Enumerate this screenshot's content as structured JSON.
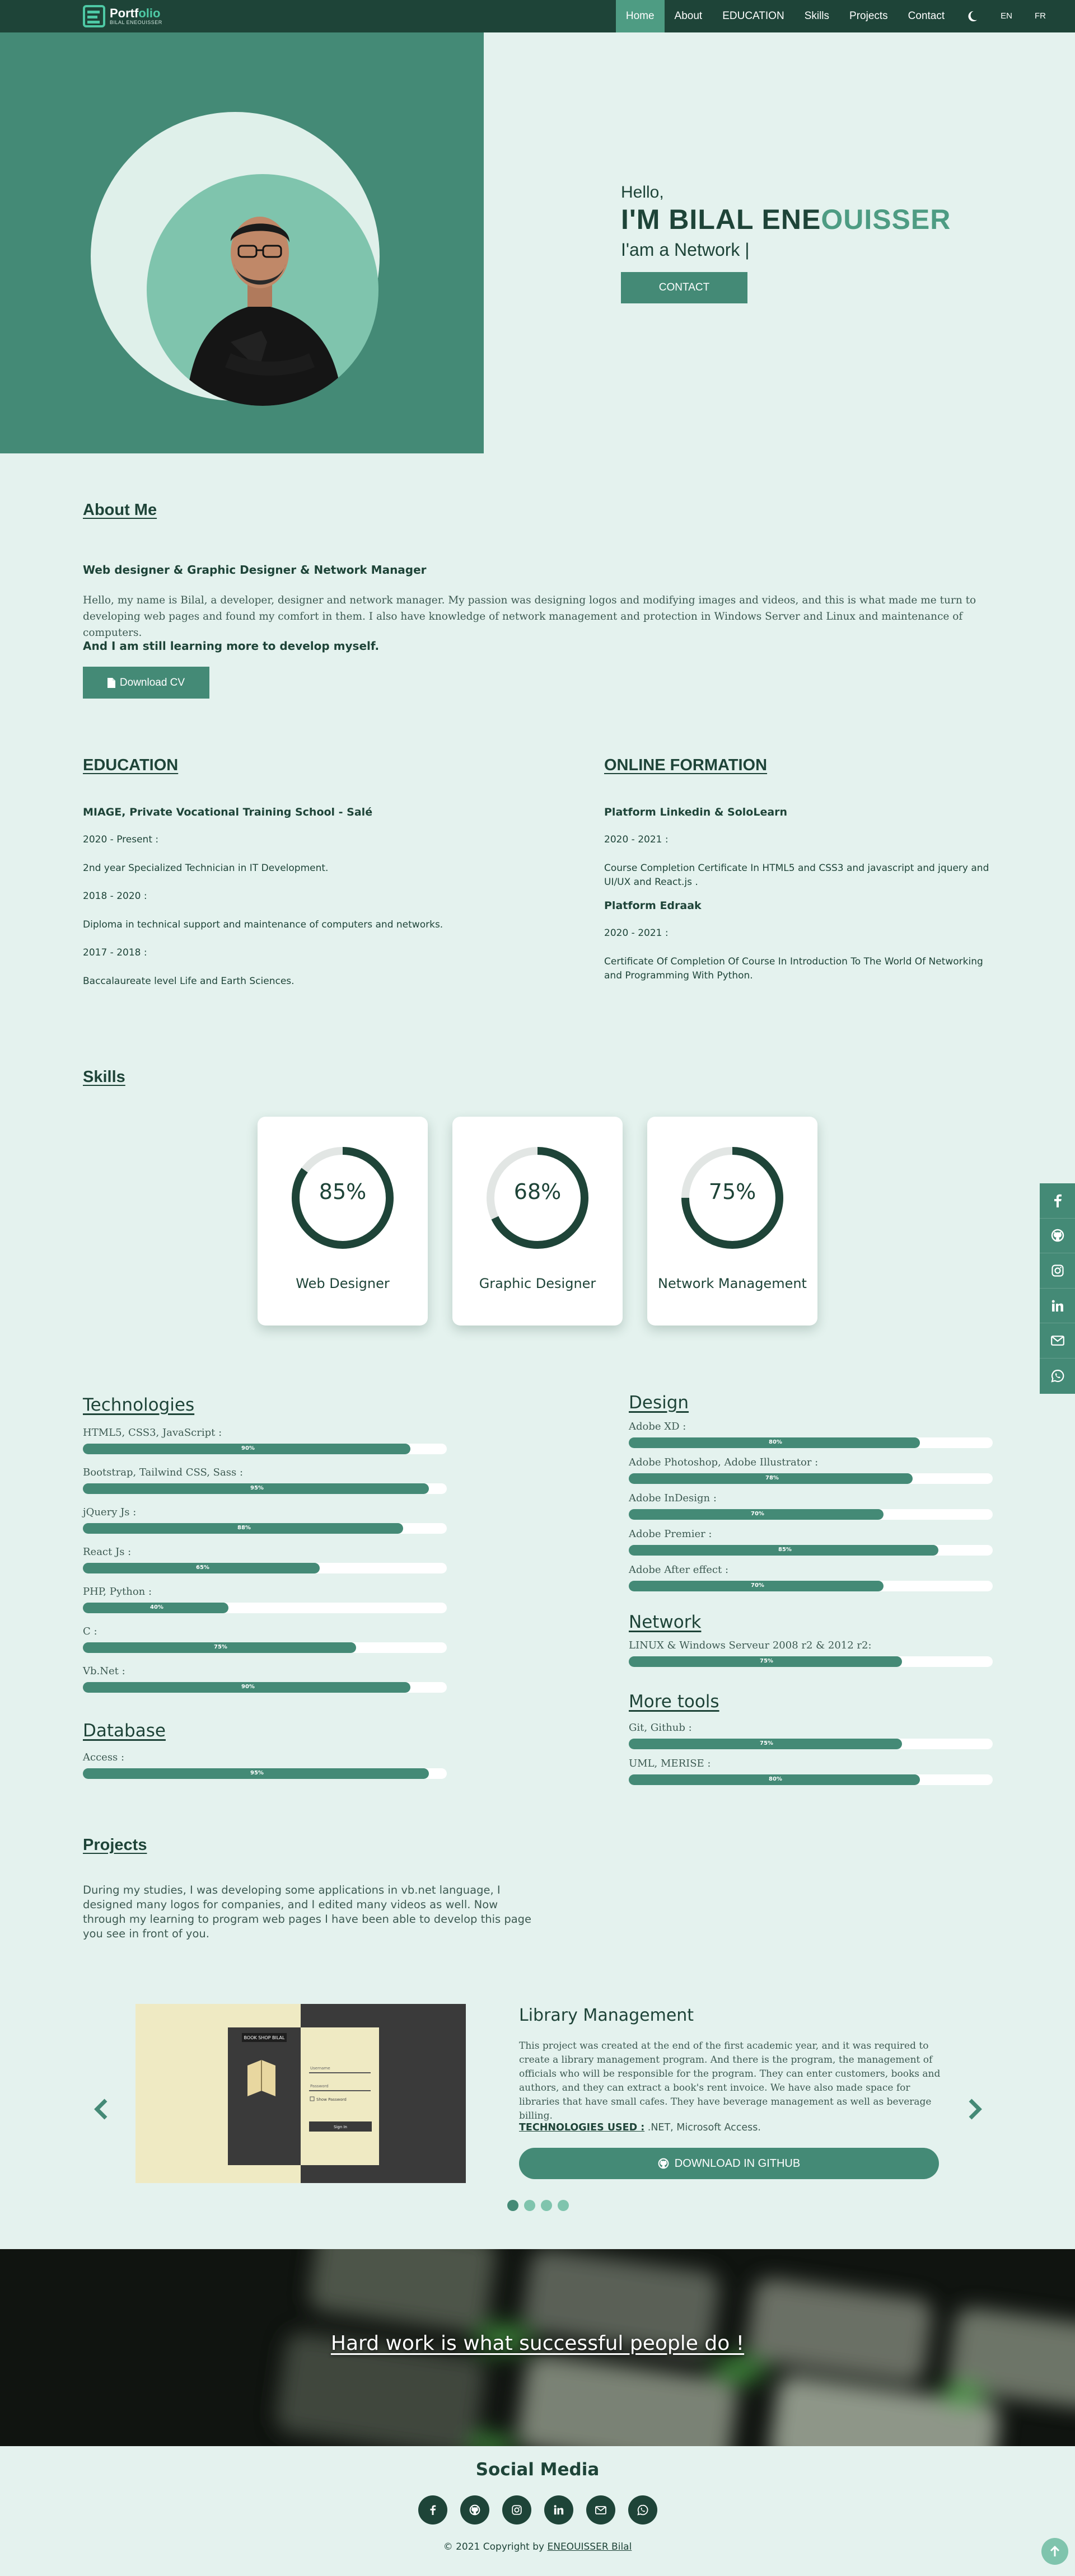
{
  "nav": {
    "logo_title_prefix": "Portf",
    "logo_title_accent": "olio",
    "logo_subtitle": "BILAL ENEOUISSER",
    "items": [
      "Home",
      "About",
      "EDUCATION",
      "Skills",
      "Projects",
      "Contact"
    ],
    "active": "Home",
    "theme_icon": "moon-icon",
    "languages": [
      "EN",
      "FR"
    ]
  },
  "hero": {
    "greeting": "Hello,",
    "name_prefix": "I'M BILAL ENE",
    "name_accent": "OUISSER",
    "typed": "I'am a Network |",
    "button": "CONTACT"
  },
  "about": {
    "heading": "About Me",
    "subtitle": "Web designer & Graphic Designer & Network Manager",
    "text": "Hello, my name is Bilal, a developer, designer and network manager. My passion was designing logos and modifying images and videos, and this is what made me turn to developing web pages and found my comfort in them. I also have knowledge of network management and protection in Windows Server and Linux and maintenance of computers.",
    "learning": "And I am still learning more to develop myself.",
    "cv_button": "Download CV"
  },
  "education": {
    "heading": "EDUCATION",
    "school": "MIAGE, Private Vocational Training School - Salé",
    "entries": [
      {
        "period": "2020 - Present :",
        "detail": "2nd year Specialized Technician in IT Development."
      },
      {
        "period": "2018 - 2020 :",
        "detail": "Diploma in technical support and maintenance of computers and networks."
      },
      {
        "period": "2017 - 2018 :",
        "detail": "Baccalaureate level Life and Earth Sciences."
      }
    ]
  },
  "online": {
    "heading": "ONLINE FORMATION",
    "platforms": [
      {
        "name": "Platform Linkedin & SoloLearn",
        "period": "2020 - 2021 :",
        "detail": "Course Completion Certificate In HTML5 and CSS3 and javascript and jquery and UI/UX and React.js ."
      },
      {
        "name": "Platform Edraak",
        "period": "2020 - 2021 :",
        "detail": "Certificate Of Completion Of Course In Introduction To The World Of Networking and Programming With Python."
      }
    ]
  },
  "skills": {
    "heading": "Skills",
    "cards": [
      {
        "value": 85,
        "label": "85%",
        "name": "Web Designer"
      },
      {
        "value": 68,
        "label": "68%",
        "name": "Graphic Designer"
      },
      {
        "value": 75,
        "label": "75%",
        "name": "Network Management"
      }
    ]
  },
  "side_social": [
    "facebook-icon",
    "github-icon",
    "instagram-icon",
    "linkedin-icon",
    "email-icon",
    "whatsapp-icon"
  ],
  "bars": {
    "technologies": {
      "heading": "Technologies",
      "items": [
        {
          "label": "HTML5, CSS3, JavaScript :",
          "value": 90,
          "text": "90%"
        },
        {
          "label": "Bootstrap, Tailwind CSS, Sass :",
          "value": 95,
          "text": "95%"
        },
        {
          "label": "jQuery Js :",
          "value": 88,
          "text": "88%"
        },
        {
          "label": "React Js :",
          "value": 65,
          "text": "65%"
        },
        {
          "label": "PHP, Python :",
          "value": 40,
          "text": "40%"
        },
        {
          "label": "C :",
          "value": 75,
          "text": "75%"
        },
        {
          "label": "Vb.Net :",
          "value": 90,
          "text": "90%"
        }
      ]
    },
    "database": {
      "heading": "Database",
      "items": [
        {
          "label": "Access :",
          "value": 95,
          "text": "95%"
        }
      ]
    },
    "design": {
      "heading": "Design",
      "items": [
        {
          "label": "Adobe XD :",
          "value": 80,
          "text": "80%"
        },
        {
          "label": "Adobe Photoshop, Adobe Illustrator :",
          "value": 78,
          "text": "78%"
        },
        {
          "label": "Adobe InDesign :",
          "value": 70,
          "text": "70%"
        },
        {
          "label": "Adobe Premier :",
          "value": 85,
          "text": "85%"
        },
        {
          "label": "Adobe After effect :",
          "value": 70,
          "text": "70%"
        }
      ]
    },
    "network": {
      "heading": "Network",
      "items": [
        {
          "label": "LINUX & Windows Serveur 2008 r2 & 2012 r2:",
          "value": 75,
          "text": "75%"
        }
      ]
    },
    "more_tools": {
      "heading": "More tools",
      "items": [
        {
          "label": "Git, Github :",
          "value": 75,
          "text": "75%"
        },
        {
          "label": "UML, MERISE :",
          "value": 80,
          "text": "80%"
        }
      ]
    }
  },
  "projects": {
    "heading": "Projects",
    "intro": "During my studies, I was developing some applications in vb.net language, I designed many logos for companies, and I edited many videos as well. Now through my learning to program web pages I have been able to develop this page you see in front of you.",
    "slide": {
      "title": "Library Management",
      "description": "This project was created at the end of the first academic year, and it was required to create a library management program. And there is the program, the management of officials who will be responsible for the program. They can enter customers, books and authors, and they can extract a book's rent invoice. We have also made space for libraries that have small cafes. They have beverage management as well as beverage billing.",
      "tech_label": "TECHNOLOGIES USED :",
      "tech_value": " .NET, Microsoft Access.",
      "button": "DOWNLOAD IN GITHUB",
      "screenshot_title": "BOOK SHOP BILAL",
      "screenshot_fields": [
        "Username",
        "Password",
        "Show Password",
        "Sign In"
      ]
    },
    "slides_count": 4,
    "active_slide": 1
  },
  "quote": "Hard work is what successful people do !",
  "footer": {
    "title": "Social Media",
    "icons": [
      "facebook-icon",
      "github-icon",
      "instagram-icon",
      "linkedin-icon",
      "email-icon",
      "whatsapp-icon"
    ],
    "copyright_prefix": "© 2021 Copyright by ",
    "copyright_link": "ENEOUISSER Bilal"
  },
  "colors": {
    "primary": "#448a76",
    "dark": "#1e4438",
    "light": "#e4f2ee",
    "accent": "#4ec9a5"
  }
}
